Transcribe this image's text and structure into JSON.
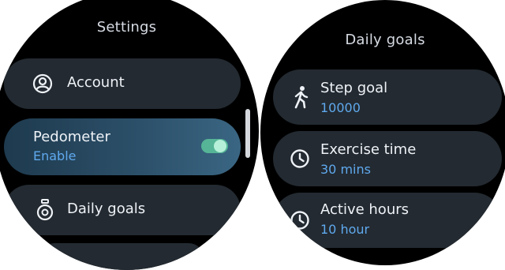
{
  "left_screen": {
    "title": "Settings",
    "items": [
      {
        "label": "Account",
        "icon": "account-circle-icon"
      },
      {
        "label": "Pedometer",
        "sub": "Enable",
        "toggle_on": true
      },
      {
        "label": "Daily goals",
        "icon": "stopwatch-icon"
      }
    ]
  },
  "right_screen": {
    "title": "Daily goals",
    "items": [
      {
        "label": "Step goal",
        "sub": "10000",
        "icon": "walking-person-icon"
      },
      {
        "label": "Exercise time",
        "sub": "30 mins",
        "icon": "clock-icon"
      },
      {
        "label": "Active hours",
        "sub": "10 hour",
        "icon": "clock-icon"
      }
    ]
  },
  "colors": {
    "screen_bg": "#000000",
    "chip_bg": "#232a31",
    "active_chip": "#2d516b",
    "accent_text": "#5fa9ee",
    "toggle_on": "#55b596"
  }
}
